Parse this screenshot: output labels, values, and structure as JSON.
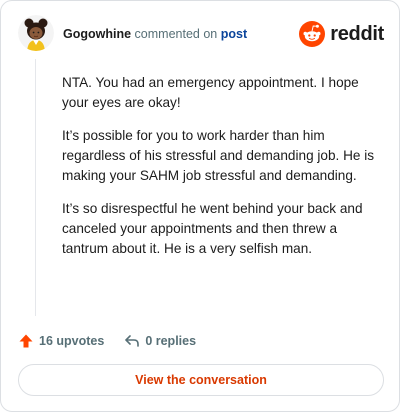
{
  "header": {
    "username": "Gogowhine",
    "action_text": "commented on",
    "target_link": "post",
    "brand_wordmark": "reddit",
    "brand_color": "#ff4500"
  },
  "comment": {
    "paragraphs": [
      "NTA. You had an emergency appointment. I hope your eyes are okay!",
      "It’s possible for you to work harder than him regardless of his stressful and demanding job. He is making your SAHM job stressful and demanding.",
      "It’s so disrespectful he went behind your back and canceled your appointments and then threw a tantrum about it. He is a very selfish man."
    ]
  },
  "actions": {
    "upvotes_label": "16 upvotes",
    "replies_label": "0 replies",
    "upvote_icon": "upvote-arrow-icon",
    "reply_icon": "reply-arrow-icon"
  },
  "cta": {
    "label": "View the conversation",
    "color": "#d93900"
  }
}
